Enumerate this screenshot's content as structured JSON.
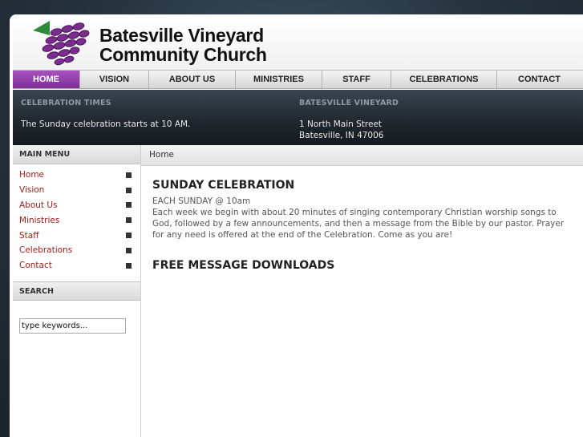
{
  "header": {
    "title_line1": "Batesville Vineyard",
    "title_line2": "Community Church"
  },
  "nav": {
    "items": [
      {
        "label": "HOME",
        "active": true
      },
      {
        "label": "VISION"
      },
      {
        "label": "ABOUT US"
      },
      {
        "label": "MINISTRIES"
      },
      {
        "label": "STAFF"
      },
      {
        "label": "CELEBRATIONS"
      },
      {
        "label": "CONTACT"
      }
    ]
  },
  "info": {
    "times_heading": "CELEBRATION TIMES",
    "times_text": "The Sunday celebration starts at 10 AM.",
    "address_heading": "BATESVILLE VINEYARD",
    "address_line1": "1 North Main Street",
    "address_line2": "Batesville, IN 47006"
  },
  "sidebar": {
    "menu_heading": "MAIN MENU",
    "menu_items": [
      "Home",
      "Vision",
      "About Us",
      "Ministries",
      "Staff",
      "Celebrations",
      "Contact"
    ],
    "search_heading": "SEARCH",
    "search_value": "type keywords..."
  },
  "breadcrumb": "Home",
  "main": {
    "heading1": "SUNDAY CELEBRATION",
    "subheading": "EACH SUNDAY @ 10am",
    "paragraph": "Each week we begin with about 20 minutes of singing contemporary Christian worship songs to God, followed by a few announcements, and then a message from the Bible by our pastor. Prayer for any need is offered at the end of the Celebration. Come as you are!",
    "heading2": "FREE MESSAGE DOWNLOADS"
  },
  "colors": {
    "accent_purple": "#8e3aa8",
    "menu_link": "#a3201c",
    "logo_leaf": "#2f8a3c"
  }
}
